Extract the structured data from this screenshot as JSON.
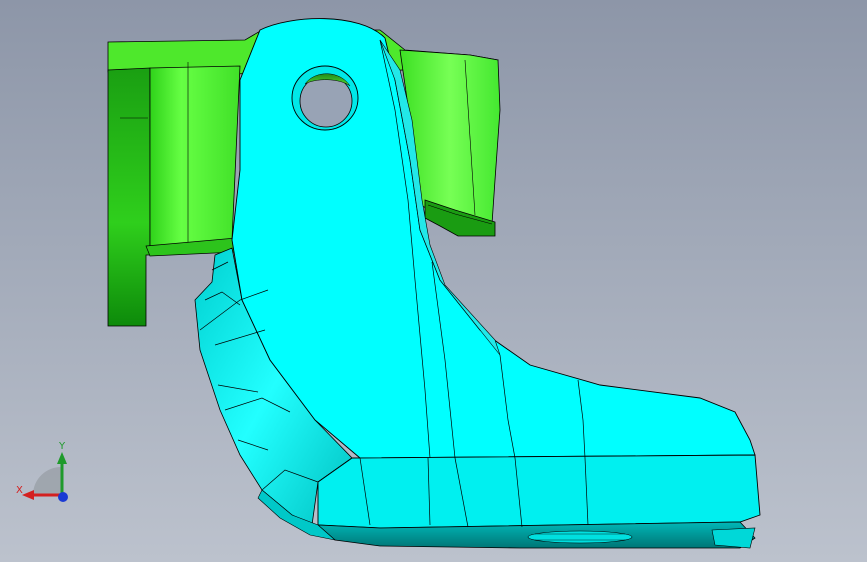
{
  "viewport": {
    "background_top": "#8d96a8",
    "background_bottom": "#bcc2cd"
  },
  "model": {
    "part_colors": {
      "lever_body": "#00ffff",
      "lever_shade": "#00c8c8",
      "lever_dark": "#008080",
      "bracket": "#55ee33",
      "bracket_dark": "#11aa11",
      "edge_lines": "#000000"
    }
  },
  "triad": {
    "x_label": "X",
    "y_label": "Y",
    "x_color": "#d42020",
    "y_color": "#1f9a2c",
    "z_color": "#1a3ad4"
  }
}
